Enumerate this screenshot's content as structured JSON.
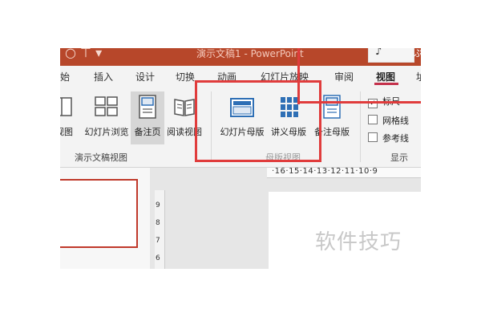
{
  "titlebar": {
    "quick_access": "○  ⊤  ▾",
    "doc_title": "演示文稿1 - PowerPoint",
    "search_glyph": "♪",
    "tail_text": "ぷ"
  },
  "tabs": [
    {
      "label": "始"
    },
    {
      "label": "插入"
    },
    {
      "label": "设计"
    },
    {
      "label": "切换"
    },
    {
      "label": "动画"
    },
    {
      "label": "幻灯片放映"
    },
    {
      "label": "审阅"
    },
    {
      "label": "视图",
      "active": true
    },
    {
      "label": "址"
    }
  ],
  "ribbon": {
    "presentation_views": {
      "buttons": [
        {
          "label": "视图",
          "icon": "normal-view-icon"
        },
        {
          "label": "幻灯片浏览",
          "icon": "slide-sorter-icon"
        },
        {
          "label": "备注页",
          "icon": "notes-page-icon",
          "selected": true
        },
        {
          "label": "阅读视图",
          "icon": "reading-view-icon"
        }
      ],
      "group_label": "演示文稿视图"
    },
    "master_views": {
      "buttons": [
        {
          "label": "幻灯片母版",
          "icon": "slide-master-icon"
        },
        {
          "label": "讲义母版",
          "icon": "handout-master-icon"
        },
        {
          "label": "备注母版",
          "icon": "notes-master-icon"
        }
      ],
      "group_label": "母版视图"
    },
    "show": {
      "checkboxes": [
        {
          "label": "标尺",
          "checked": true
        },
        {
          "label": "网格线",
          "checked": false
        },
        {
          "label": "参考线",
          "checked": false
        }
      ],
      "group_label": "显示"
    }
  },
  "rulers": {
    "horizontal": "·16·15·14·13·12·11·10·9",
    "vertical": [
      "9",
      "8",
      "7",
      "6"
    ]
  },
  "watermark": "软件技巧",
  "colors": {
    "accent": "#b7472a",
    "highlight": "#e03c3c",
    "tab_underline": "#c4314b"
  }
}
